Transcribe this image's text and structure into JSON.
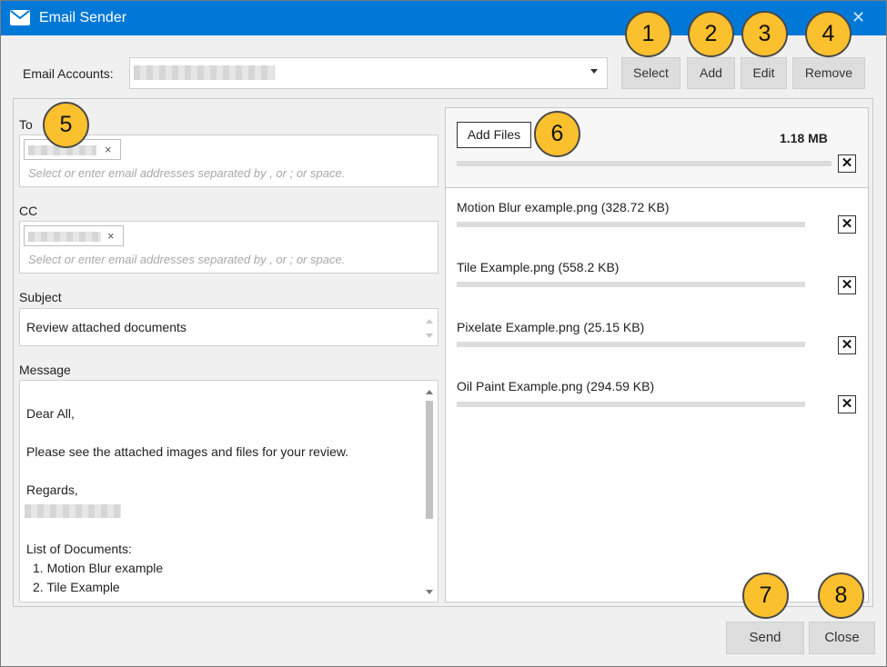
{
  "window": {
    "title": "Email Sender",
    "close_glyph": "✕",
    "icon": "envelope-icon"
  },
  "accounts": {
    "label": "Email Accounts:"
  },
  "toolbar": {
    "select": "Select",
    "add": "Add",
    "edit": "Edit",
    "remove": "Remove"
  },
  "callouts": [
    "1",
    "2",
    "3",
    "4",
    "5",
    "6",
    "7",
    "8"
  ],
  "to": {
    "label": "To",
    "chip_remove": "×",
    "placeholder": "Select or enter email addresses separated by , or ; or space."
  },
  "cc": {
    "label": "CC",
    "chip_remove": "×",
    "placeholder": "Select or enter email addresses separated by , or ; or space."
  },
  "subject": {
    "label": "Subject",
    "value": "Review attached documents"
  },
  "message": {
    "label": "Message",
    "lines": [
      "Dear All,",
      "Please see the attached images and files for your review.",
      "Regards,",
      "List of Documents:",
      "1. Motion Blur example",
      "2. Tile Example"
    ]
  },
  "attachments": {
    "add_label": "Add Files",
    "total_size": "1.18 MB",
    "remove_glyph": "✕",
    "files": [
      {
        "name": "Motion Blur example.png",
        "size": "(328.72 KB)"
      },
      {
        "name": "Tile Example.png",
        "size": "(558.2 KB)"
      },
      {
        "name": "Pixelate Example.png",
        "size": "(25.15 KB)"
      },
      {
        "name": "Oil Paint Example.png",
        "size": "(294.59 KB)"
      }
    ]
  },
  "footer": {
    "send": "Send",
    "close": "Close"
  }
}
